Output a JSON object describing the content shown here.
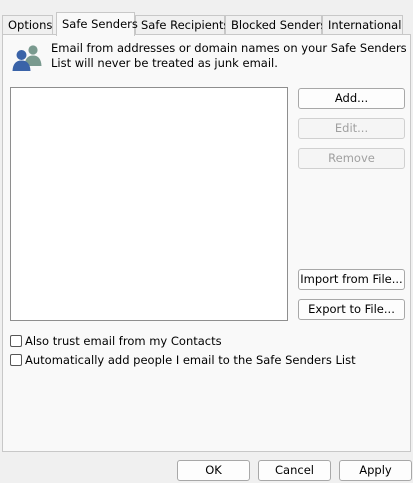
{
  "tabs": [
    {
      "label": "Options"
    },
    {
      "label": "Safe Senders"
    },
    {
      "label": "Safe Recipients"
    },
    {
      "label": "Blocked Senders"
    },
    {
      "label": "International"
    }
  ],
  "header": {
    "icon": "people-icon",
    "description": "Email from addresses or domain names on your Safe Senders List will never be treated as junk email."
  },
  "list": {
    "items": []
  },
  "buttons": {
    "add": "Add...",
    "edit": "Edit...",
    "remove": "Remove",
    "import": "Import from File...",
    "export": "Export to File..."
  },
  "options": {
    "trust_contacts": "Also trust email from my Contacts",
    "auto_add": "Automatically add people I email to the Safe Senders List"
  },
  "dialog": {
    "ok": "OK",
    "cancel": "Cancel",
    "apply": "Apply"
  }
}
